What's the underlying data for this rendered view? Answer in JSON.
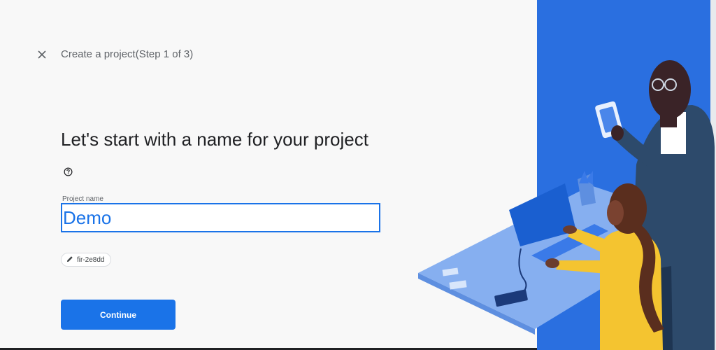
{
  "header": {
    "step_title": "Create a project(Step 1 of 3)"
  },
  "main": {
    "heading": "Let's start with a name for your project",
    "field_label": "Project name",
    "project_name_value": "Demo",
    "project_id_chip": "fir-2e8dd",
    "continue_label": "Continue"
  },
  "icons": {
    "close": "close-icon",
    "help": "help-icon",
    "edit": "pencil-icon"
  },
  "colors": {
    "accent": "#1a73e8",
    "panel_blue": "#2a6fe0"
  }
}
